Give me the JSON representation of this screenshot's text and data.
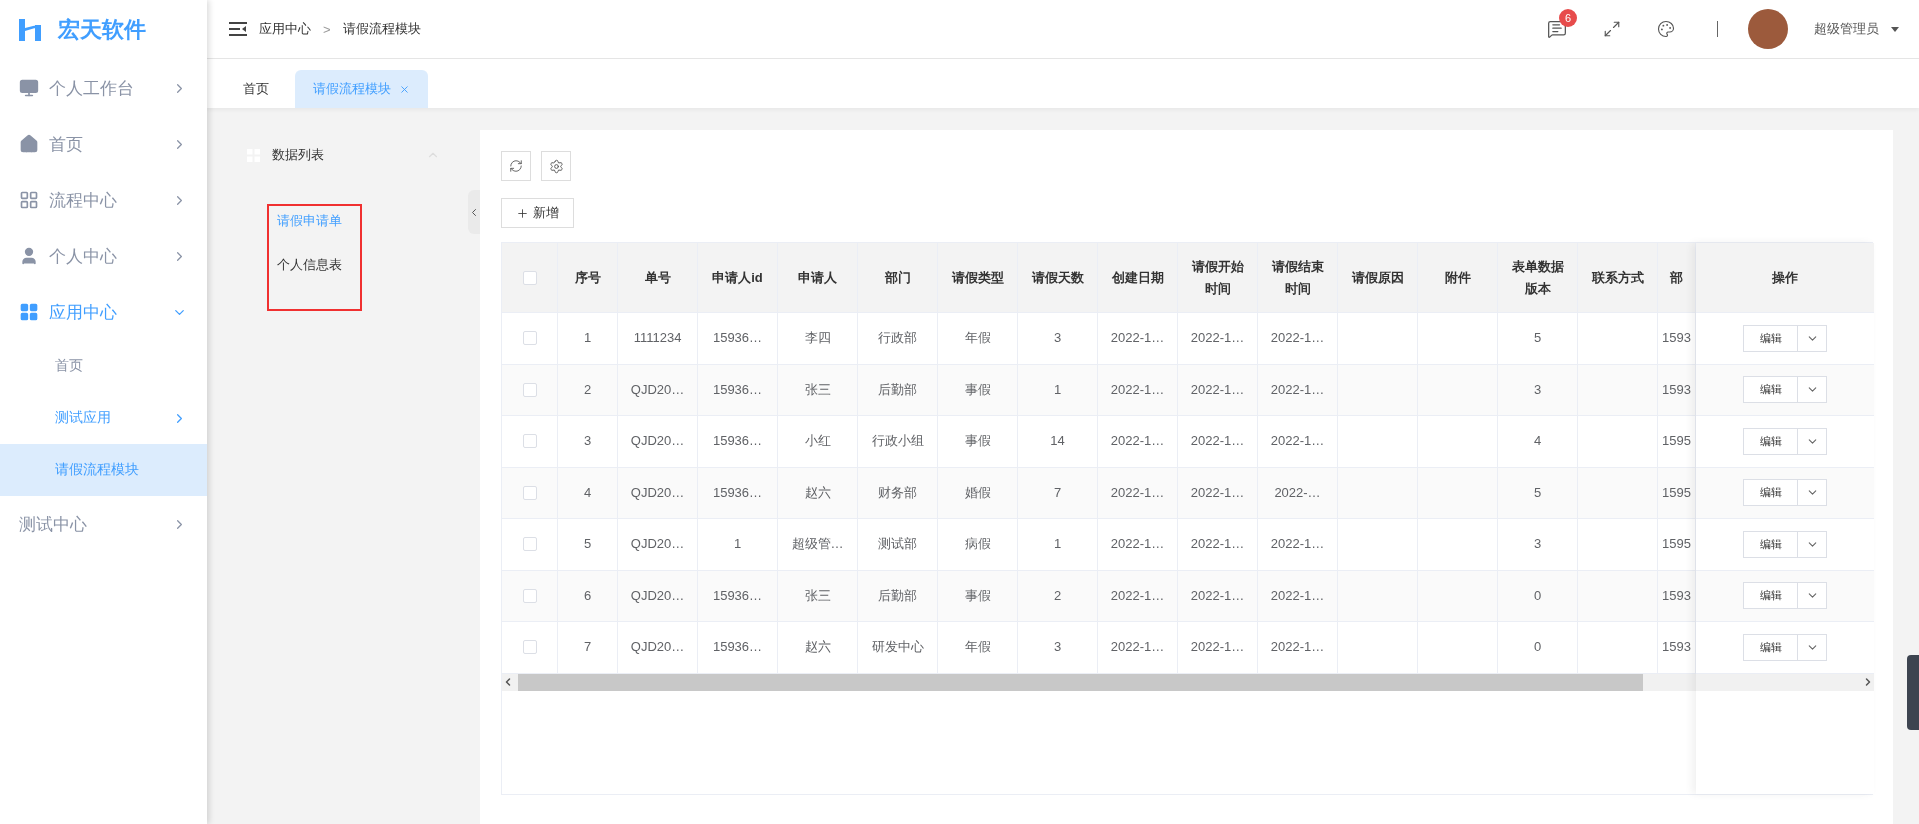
{
  "sidebar": {
    "logo": "宏天软件",
    "items": [
      {
        "label": "个人工作台",
        "kind": "group",
        "expanded": false,
        "active": false,
        "selected": false
      },
      {
        "label": "首页",
        "kind": "group",
        "expanded": false,
        "active": false,
        "selected": false
      },
      {
        "label": "流程中心",
        "kind": "group",
        "expanded": false,
        "active": false,
        "selected": false
      },
      {
        "label": "个人中心",
        "kind": "group",
        "expanded": false,
        "active": false,
        "selected": false
      },
      {
        "label": "应用中心",
        "kind": "group",
        "expanded": true,
        "active": true,
        "selected": false,
        "children": [
          {
            "label": "首页",
            "kind": "link",
            "active": false,
            "selected": false
          },
          {
            "label": "测试应用",
            "kind": "group",
            "expanded": false,
            "active": true,
            "selected": false
          },
          {
            "label": "请假流程模块",
            "kind": "link",
            "active": true,
            "selected": true
          }
        ]
      },
      {
        "label": "测试中心",
        "kind": "group",
        "expanded": false,
        "active": false,
        "selected": false
      }
    ]
  },
  "topbar": {
    "breadcrumb": [
      "应用中心",
      "请假流程模块"
    ],
    "breadcrumb_separator": ">",
    "notification_count": "6",
    "user": "超级管理员"
  },
  "tabs": [
    {
      "label": "首页",
      "selected": false,
      "closable": false
    },
    {
      "label": "请假流程模块",
      "selected": true,
      "closable": true
    }
  ],
  "left_panel": {
    "title": "数据列表",
    "items": [
      {
        "label": "请假申请单",
        "selected": true
      },
      {
        "label": "个人信息表",
        "selected": false
      }
    ]
  },
  "toolbar": {
    "add_button": "新增"
  },
  "table": {
    "select_all_checked": false,
    "columns": [
      "序号",
      "单号",
      "申请人id",
      "申请人",
      "部门",
      "请假类型",
      "请假天数",
      "创建日期",
      "请假开始时间",
      "请假结束时间",
      "请假原因",
      "附件",
      "表单数据版本",
      "联系方式",
      "部"
    ],
    "action_column": "操作",
    "rows": [
      {
        "checked": false,
        "cells": [
          "1",
          "1111234",
          "15936…",
          "李四",
          "行政部",
          "年假",
          "3",
          "2022-1…",
          "2022-1…",
          "2022-1…",
          "",
          "",
          "5",
          "",
          "1593"
        ],
        "action": "编辑"
      },
      {
        "checked": false,
        "cells": [
          "2",
          "QJD20…",
          "15936…",
          "张三",
          "后勤部",
          "事假",
          "1",
          "2022-1…",
          "2022-1…",
          "2022-1…",
          "",
          "",
          "3",
          "",
          "1593"
        ],
        "action": "编辑"
      },
      {
        "checked": false,
        "cells": [
          "3",
          "QJD20…",
          "15936…",
          "小红",
          "行政小组",
          "事假",
          "14",
          "2022-1…",
          "2022-1…",
          "2022-1…",
          "",
          "",
          "4",
          "",
          "1595"
        ],
        "action": "编辑"
      },
      {
        "checked": false,
        "cells": [
          "4",
          "QJD20…",
          "15936…",
          "赵六",
          "财务部",
          "婚假",
          "7",
          "2022-1…",
          "2022-1…",
          "2022-…",
          "",
          "",
          "5",
          "",
          "1595"
        ],
        "action": "编辑"
      },
      {
        "checked": false,
        "cells": [
          "5",
          "QJD20…",
          "1",
          "超级管…",
          "测试部",
          "病假",
          "1",
          "2022-1…",
          "2022-1…",
          "2022-1…",
          "",
          "",
          "3",
          "",
          "1595"
        ],
        "action": "编辑"
      },
      {
        "checked": false,
        "cells": [
          "6",
          "QJD20…",
          "15936…",
          "张三",
          "后勤部",
          "事假",
          "2",
          "2022-1…",
          "2022-1…",
          "2022-1…",
          "",
          "",
          "0",
          "",
          "1593"
        ],
        "action": "编辑"
      },
      {
        "checked": false,
        "cells": [
          "7",
          "QJD20…",
          "15936…",
          "赵六",
          "研发中心",
          "年假",
          "3",
          "2022-1…",
          "2022-1…",
          "2022-1…",
          "",
          "",
          "0",
          "",
          "1593"
        ],
        "action": "编辑"
      }
    ]
  }
}
